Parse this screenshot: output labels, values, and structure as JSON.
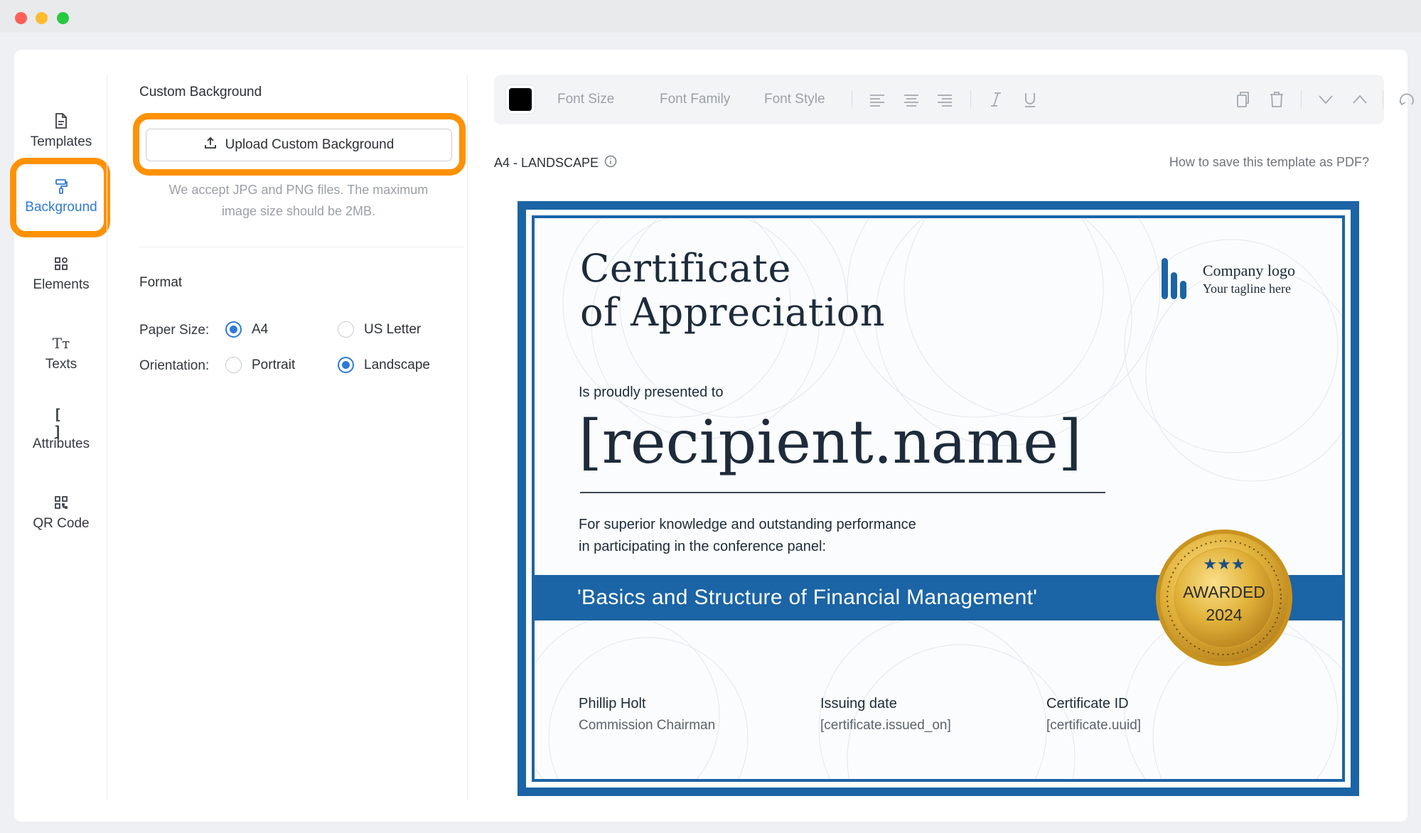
{
  "window_controls": {
    "close": "close",
    "minimize": "minimize",
    "zoom": "zoom"
  },
  "nav": {
    "items": [
      {
        "label": "Templates",
        "icon": "document-icon"
      },
      {
        "label": "Background",
        "icon": "paint-roller-icon",
        "active": true
      },
      {
        "label": "Elements",
        "icon": "elements-icon"
      },
      {
        "label": "Texts",
        "icon": "text-icon"
      },
      {
        "label": "Attributes",
        "icon": "brackets-icon"
      },
      {
        "label": "QR Code",
        "icon": "qr-code-icon"
      }
    ]
  },
  "panel": {
    "custom_bg_title": "Custom Background",
    "upload_label": "Upload Custom Background",
    "accept_note": "We accept JPG and PNG files. The maximum image size should be 2MB.",
    "format_title": "Format",
    "paper_size_label": "Paper Size:",
    "paper_options": [
      {
        "label": "A4",
        "checked": true
      },
      {
        "label": "US Letter",
        "checked": false
      }
    ],
    "orientation_label": "Orientation:",
    "orientation_options": [
      {
        "label": "Portrait",
        "checked": false
      },
      {
        "label": "Landscape",
        "checked": true
      }
    ]
  },
  "toolbar": {
    "color": "#000000",
    "font_size": "Font Size",
    "font_family": "Font Family",
    "font_style": "Font Style"
  },
  "canvas": {
    "paper_label": "A4 - LANDSCAPE",
    "help_link": "How to save this template as PDF?"
  },
  "certificate": {
    "title_line1": "Certificate",
    "title_line2": "of Appreciation",
    "logo_name": "Company logo",
    "logo_tagline": "Your tagline here",
    "presented_to": "Is proudly presented to",
    "recipient": "[recipient.name]",
    "desc_line1": "For superior knowledge and outstanding performance",
    "desc_line2": "in participating in the conference panel:",
    "banner": "'Basics and Structure of Financial Management'",
    "seal_line1": "AWARDED",
    "seal_line2": "2024",
    "signer_name": "Phillip Holt",
    "signer_title": "Commission Chairman",
    "issuing_label": "Issuing date",
    "issuing_value": "[certificate.issued_on]",
    "id_label": "Certificate ID",
    "id_value": "[certificate.uuid]",
    "accent_color": "#1b64a5",
    "gold_color": "#e1b23a"
  },
  "highlight_color": "#ff9105"
}
